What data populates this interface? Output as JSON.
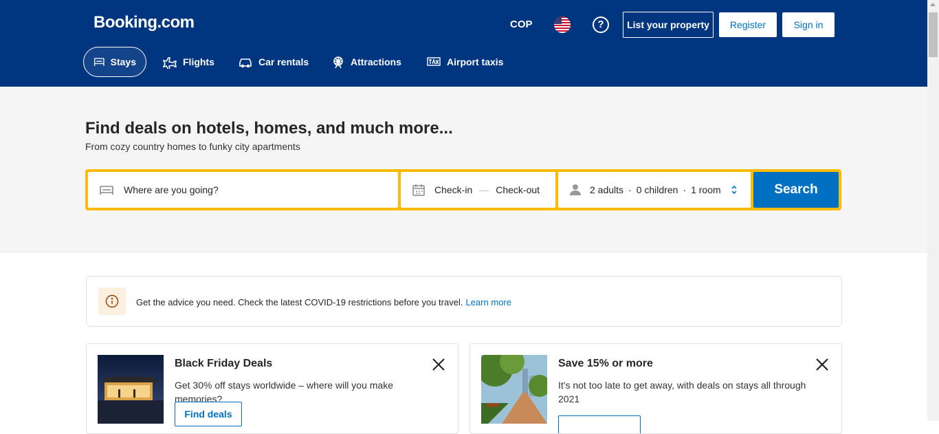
{
  "header": {
    "logo": "Booking.com",
    "currency": "COP",
    "help": "?",
    "list_property": "List your property",
    "register": "Register",
    "sign_in": "Sign in"
  },
  "nav": {
    "stays": "Stays",
    "flights": "Flights",
    "car_rentals": "Car rentals",
    "attractions": "Attractions",
    "airport_taxis": "Airport taxis"
  },
  "hero": {
    "title": "Find deals on hotels, homes, and much more...",
    "subtitle": "From cozy country homes to funky city apartments"
  },
  "search": {
    "destination_placeholder": "Where are you going?",
    "check_in": "Check-in",
    "check_out": "Check-out",
    "dash": "—",
    "adults": "2 adults",
    "children": "0 children",
    "rooms": "1 room",
    "sep": "·",
    "button": "Search"
  },
  "alert": {
    "text": "Get the advice you need. Check the latest COVID-19 restrictions before you travel.",
    "link": "Learn more"
  },
  "cards": [
    {
      "title": "Black Friday Deals",
      "text": "Get 30% off stays worldwide – where will you make memories?",
      "button": "Find deals"
    },
    {
      "title": "Save 15% or more",
      "text": "It's not too late to get away, with deals on stays all through 2021",
      "button": ""
    }
  ],
  "colors": {
    "brand": "#003580",
    "search_border": "#febb02",
    "primary": "#0071c2"
  }
}
